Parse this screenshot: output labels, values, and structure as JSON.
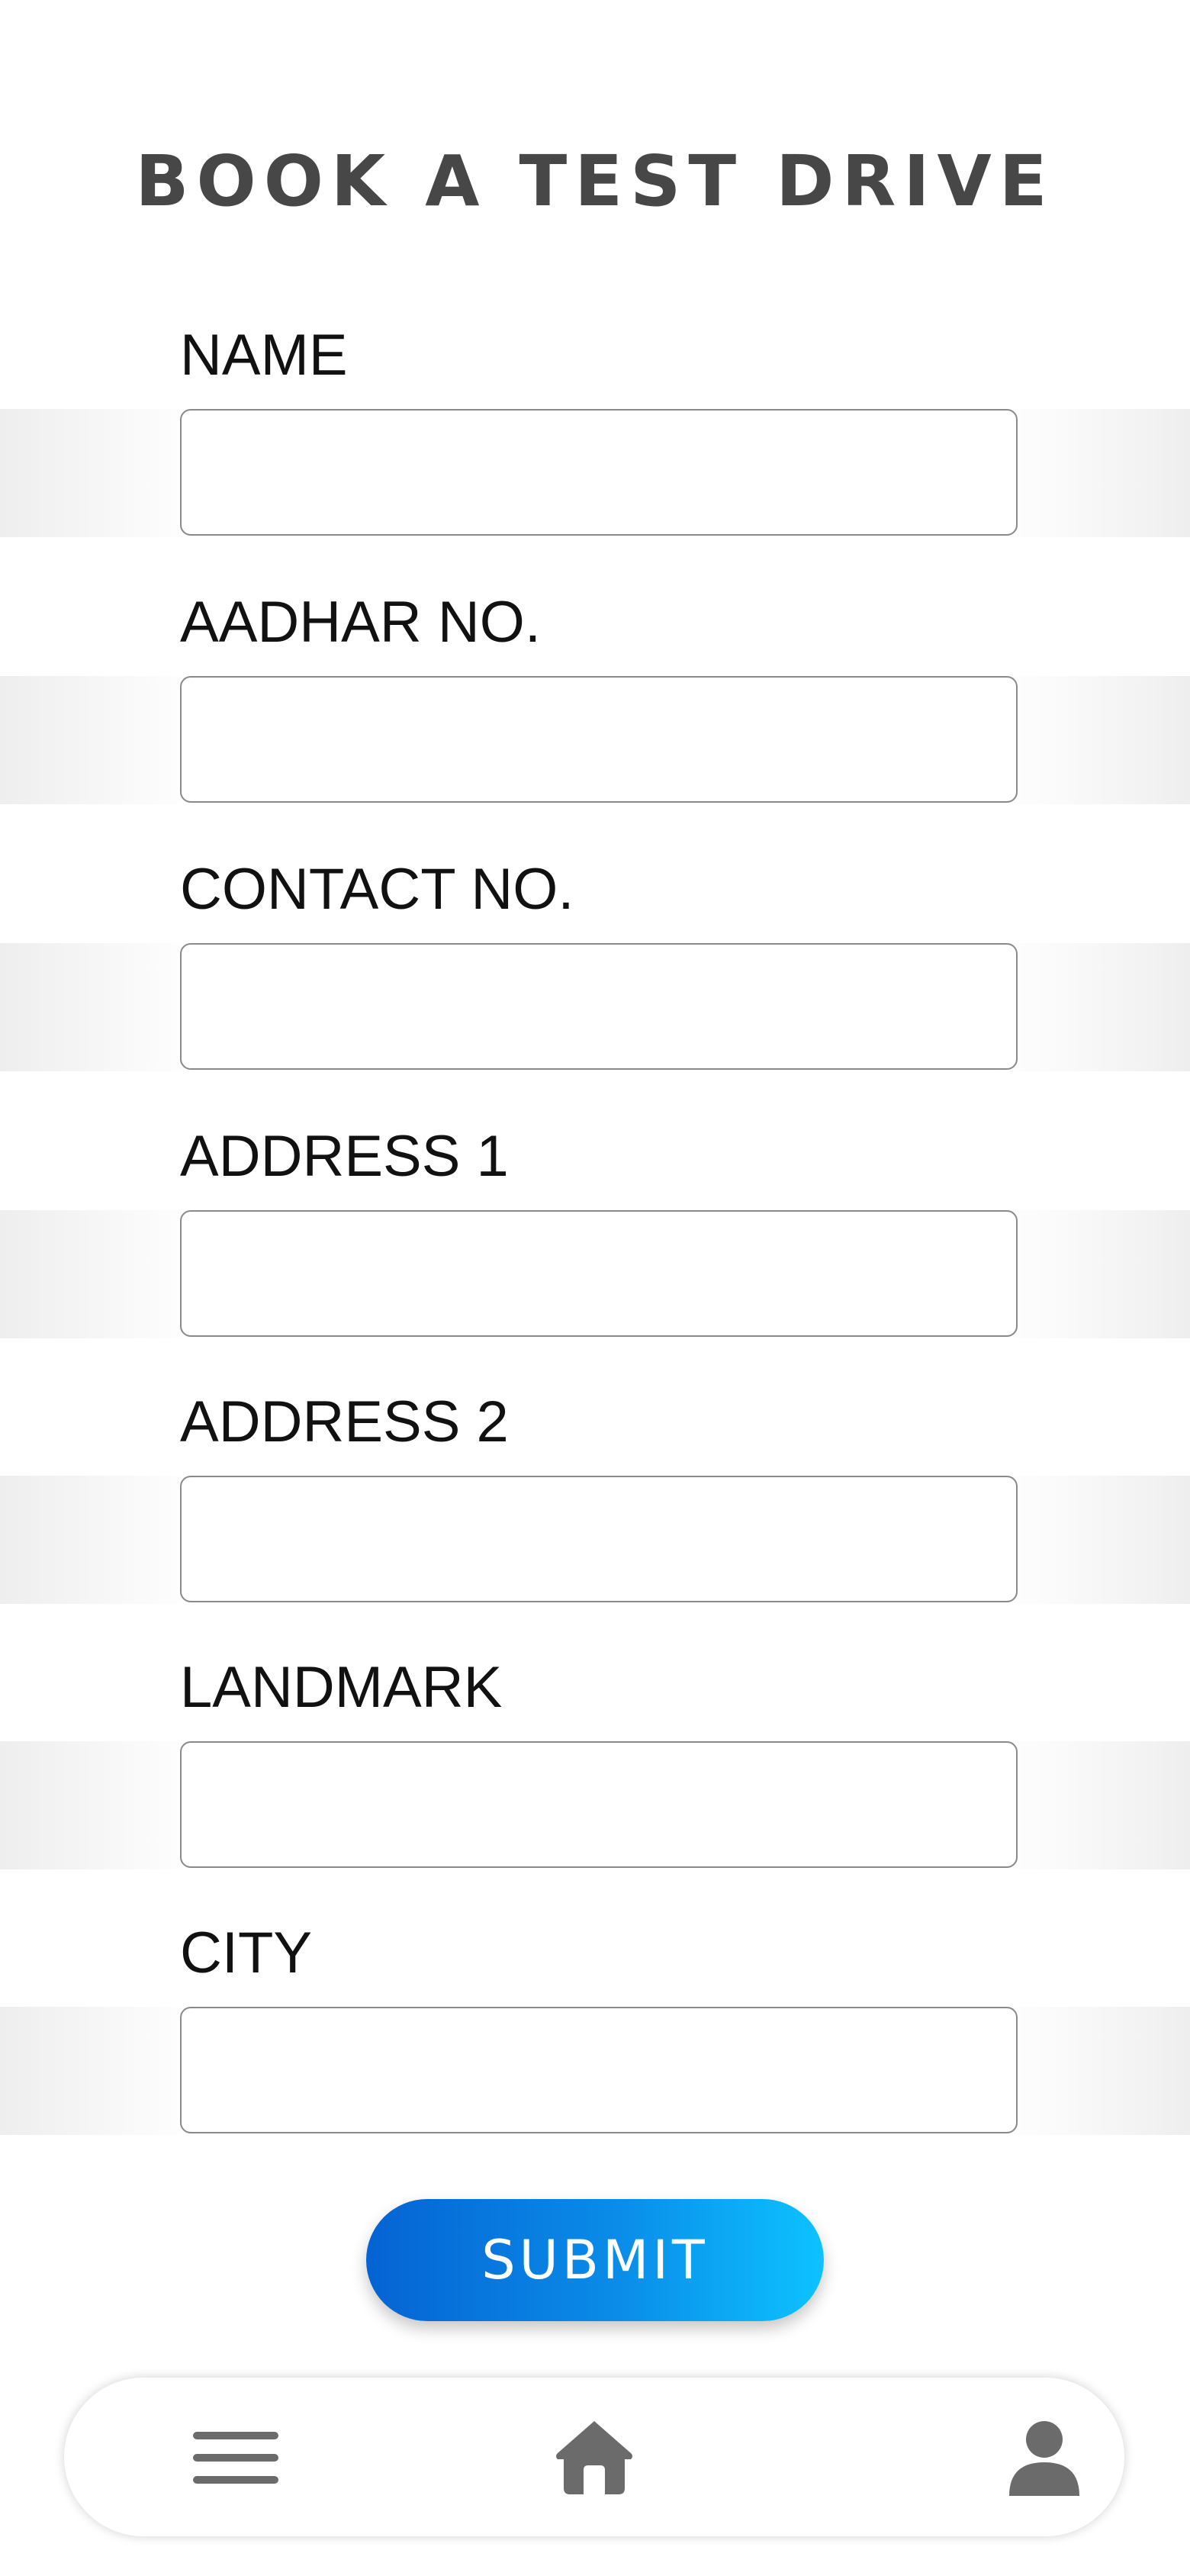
{
  "page": {
    "title": "BOOK A TEST DRIVE"
  },
  "form": {
    "fields": [
      {
        "label": "NAME",
        "value": "",
        "placeholder": ""
      },
      {
        "label": "AADHAR NO.",
        "value": "",
        "placeholder": ""
      },
      {
        "label": "CONTACT NO.",
        "value": "",
        "placeholder": ""
      },
      {
        "label": "ADDRESS 1",
        "value": "",
        "placeholder": ""
      },
      {
        "label": "ADDRESS 2",
        "value": "",
        "placeholder": ""
      },
      {
        "label": "LANDMARK",
        "value": "",
        "placeholder": ""
      },
      {
        "label": "CITY",
        "value": "",
        "placeholder": ""
      }
    ],
    "submit_label": "SUBMIT"
  },
  "bottom_nav": {
    "items": [
      {
        "icon": "menu-icon"
      },
      {
        "icon": "home-icon"
      },
      {
        "icon": "profile-icon"
      }
    ]
  },
  "colors": {
    "title": "#474747",
    "submit_gradient_start": "#0563d3",
    "submit_gradient_end": "#0dc2ff",
    "nav_icon": "#6b6b6b"
  }
}
